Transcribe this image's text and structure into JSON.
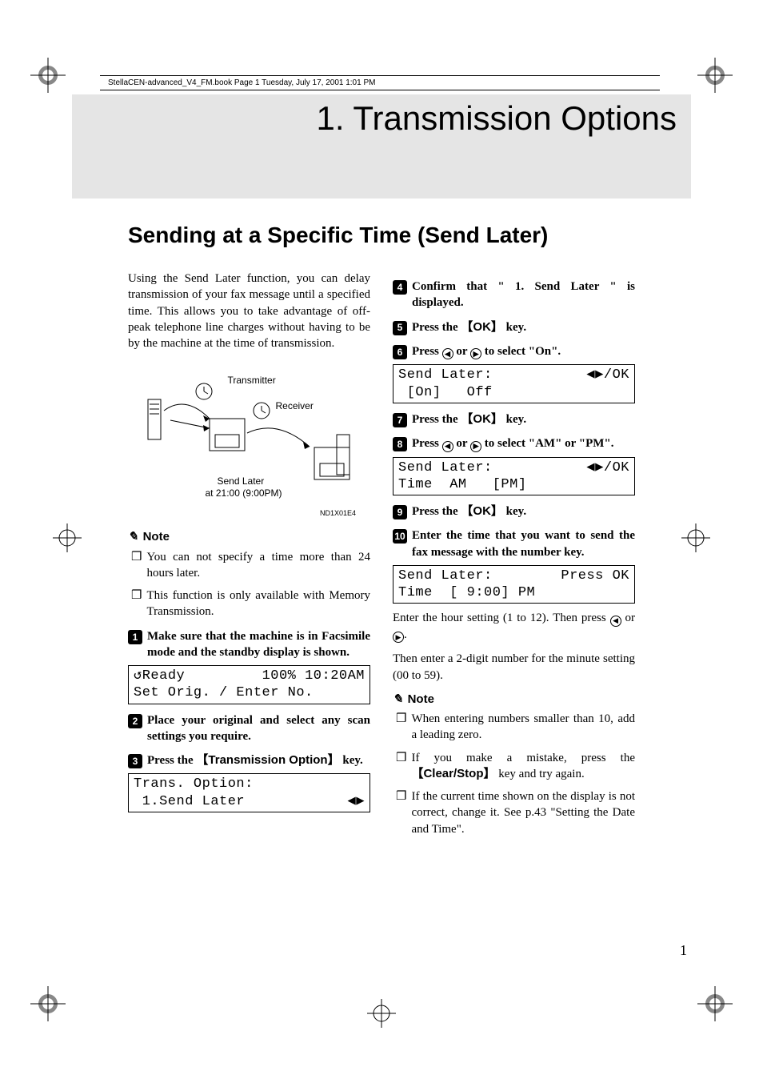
{
  "header_strip": "StellaCEN-advanced_V4_FM.book  Page 1  Tuesday, July 17, 2001  1:01 PM",
  "chapter": {
    "title": "1. Transmission Options"
  },
  "section": {
    "title": "Sending at a Specific Time (Send Later)"
  },
  "intro": "Using the Send Later function, you can delay transmission of your fax message until a specified time. This allows you to take advantage of off-peak telephone line charges without having to be by the machine at the time of transmission.",
  "diagram": {
    "transmitter_label": "Transmitter",
    "receiver_label": "Receiver",
    "send_later_label": "Send Later",
    "time_label": "at 21:00 (9:00PM)",
    "code": "ND1X01E4"
  },
  "note_heading": "Note",
  "notes_left": [
    "You can not specify a time more than 24 hours later.",
    "This function is only available with Memory Transmission."
  ],
  "steps_left": [
    {
      "n": "1",
      "text_pre": "Make sure that the machine is in Facsimile mode and the standby display is shown."
    },
    {
      "n": "2",
      "text_pre": "Place your original and select any scan settings you require."
    },
    {
      "n": "3",
      "text_pre": "Press the ",
      "key": "Transmission Option",
      "text_post": " key."
    }
  ],
  "lcd_left_1": {
    "line1_left": "↺Ready",
    "line1_right": "100% 10:20AM",
    "line2": "Set Orig. / Enter No."
  },
  "lcd_left_2": {
    "line1": "Trans. Option:",
    "line2_left": " 1.Send Later",
    "line2_right": "◀▶"
  },
  "steps_right": [
    {
      "n": "4",
      "text_pre": "Confirm that \" 1. Send Later \" is displayed."
    },
    {
      "n": "5",
      "text_pre": "Press the ",
      "key": "OK",
      "text_post": " key."
    },
    {
      "n": "6",
      "text_pre": "Press ",
      "arrows": true,
      "text_post": " to select \"On\"."
    },
    {
      "n": "7",
      "text_pre": "Press the ",
      "key": "OK",
      "text_post": " key."
    },
    {
      "n": "8",
      "text_pre": "Press ",
      "arrows": true,
      "text_post": " to select \"AM\" or \"PM\"."
    },
    {
      "n": "9",
      "text_pre": "Press the ",
      "key": "OK",
      "text_post": " key."
    },
    {
      "n": "10",
      "text_pre": "Enter the time that you want to send the fax message with the number key."
    }
  ],
  "lcd_right_1": {
    "line1_left": "Send Later:",
    "line1_right": "◀▶/OK",
    "line2": " [On]   Off"
  },
  "lcd_right_2": {
    "line1_left": "Send Later:",
    "line1_right": "◀▶/OK",
    "line2": "Time  AM   [PM]"
  },
  "lcd_right_3": {
    "line1_left": "Send Later:",
    "line1_right": "Press OK",
    "line2": "Time  [ 9:00] PM"
  },
  "body_right_1_pre": "Enter the hour setting (1 to 12). Then press ",
  "body_right_1_post": ".",
  "body_right_2": "Then enter a 2-digit number for the minute setting (00 to 59).",
  "notes_right": [
    {
      "text": "When entering numbers smaller than 10, add a leading zero."
    },
    {
      "text_pre": "If you make a mistake, press the ",
      "key": "Clear/Stop",
      "text_post": " key and try again."
    },
    {
      "text": "If the current time shown on the display is not correct, change it. See p.43 \"Setting the Date and Time\"."
    }
  ],
  "page_number": "1"
}
